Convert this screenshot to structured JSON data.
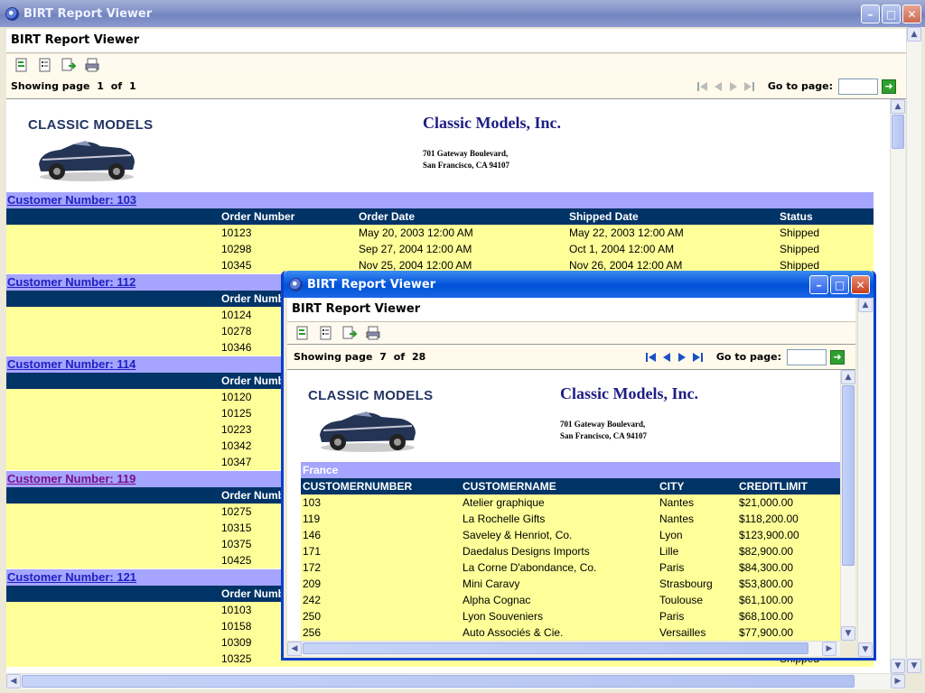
{
  "main_window": {
    "title": "BIRT Report Viewer",
    "app_title": "BIRT Report Viewer",
    "showing": {
      "label": "Showing page",
      "current": "1",
      "of": "of",
      "total": "1"
    },
    "goto_label": "Go to page:",
    "report": {
      "logo_text": "CLASSIC MODELS",
      "company": "Classic Models, Inc.",
      "address_line1": "701 Gateway Boulevard,",
      "address_line2": "San Francisco, CA 94107",
      "columns": [
        "Order Number",
        "Order Date",
        "Shipped Date",
        "Status"
      ],
      "groups": [
        {
          "label": "Customer Number: 103",
          "visited": false,
          "rows": [
            [
              "10123",
              "May 20, 2003 12:00 AM",
              "May 22, 2003 12:00 AM",
              "Shipped"
            ],
            [
              "10298",
              "Sep 27, 2004 12:00 AM",
              "Oct 1, 2004 12:00 AM",
              "Shipped"
            ],
            [
              "10345",
              "Nov 25, 2004 12:00 AM",
              "Nov 26, 2004 12:00 AM",
              "Shipped"
            ]
          ]
        },
        {
          "label": "Customer Number: 112",
          "visited": false,
          "rows": [
            [
              "10124",
              "",
              "",
              ""
            ],
            [
              "10278",
              "",
              "",
              ""
            ],
            [
              "10346",
              "",
              "",
              ""
            ]
          ]
        },
        {
          "label": "Customer Number: 114",
          "visited": false,
          "rows": [
            [
              "10120",
              "",
              "",
              ""
            ],
            [
              "10125",
              "",
              "",
              ""
            ],
            [
              "10223",
              "",
              "",
              ""
            ],
            [
              "10342",
              "",
              "",
              ""
            ],
            [
              "10347",
              "",
              "",
              ""
            ]
          ]
        },
        {
          "label": "Customer Number: 119",
          "visited": true,
          "rows": [
            [
              "10275",
              "",
              "",
              ""
            ],
            [
              "10315",
              "",
              "",
              ""
            ],
            [
              "10375",
              "",
              "",
              ""
            ],
            [
              "10425",
              "",
              "",
              ""
            ]
          ]
        },
        {
          "label": "Customer Number: 121",
          "visited": false,
          "rows": [
            [
              "10103",
              "",
              "",
              ""
            ],
            [
              "10158",
              "",
              "",
              ""
            ],
            [
              "10309",
              "",
              "",
              ""
            ],
            [
              "10325",
              "",
              "",
              "Shipped"
            ]
          ]
        }
      ]
    }
  },
  "popup_window": {
    "title": "BIRT Report Viewer",
    "app_title": "BIRT Report Viewer",
    "showing": {
      "label": "Showing page",
      "current": "7",
      "of": "of",
      "total": "28"
    },
    "goto_label": "Go to page:",
    "report": {
      "logo_text": "CLASSIC MODELS",
      "company": "Classic Models, Inc.",
      "address_line1": "701 Gateway Boulevard,",
      "address_line2": "San Francisco, CA 94107",
      "country": "France",
      "columns": [
        "CUSTOMERNUMBER",
        "CUSTOMERNAME",
        "CITY",
        "CREDITLIMIT"
      ],
      "rows": [
        [
          "103",
          "Atelier graphique",
          "Nantes",
          "$21,000.00"
        ],
        [
          "119",
          "La Rochelle Gifts",
          "Nantes",
          "$118,200.00"
        ],
        [
          "146",
          "Saveley & Henriot, Co.",
          "Lyon",
          "$123,900.00"
        ],
        [
          "171",
          "Daedalus Designs Imports",
          "Lille",
          "$82,900.00"
        ],
        [
          "172",
          "La Corne D'abondance, Co.",
          "Paris",
          "$84,300.00"
        ],
        [
          "209",
          "Mini Caravy",
          "Strasbourg",
          "$53,800.00"
        ],
        [
          "242",
          "Alpha Cognac",
          "Toulouse",
          "$61,100.00"
        ],
        [
          "250",
          "Lyon Souveniers",
          "Paris",
          "$68,100.00"
        ],
        [
          "256",
          "Auto Associés & Cie.",
          "Versailles",
          "$77,900.00"
        ]
      ]
    }
  },
  "icons": {
    "window": "app-icon",
    "toolbar": [
      "toc-icon",
      "parameters-icon",
      "export-icon",
      "print-icon"
    ],
    "pager": [
      "first-page-icon",
      "prev-page-icon",
      "next-page-icon",
      "last-page-icon",
      "go-icon"
    ]
  },
  "colors": {
    "group_header": "#a5a5ff",
    "column_header": "#003366",
    "row_bg": "#ffff99",
    "link": "#2020c0",
    "visited_link": "#7a0f8a"
  }
}
